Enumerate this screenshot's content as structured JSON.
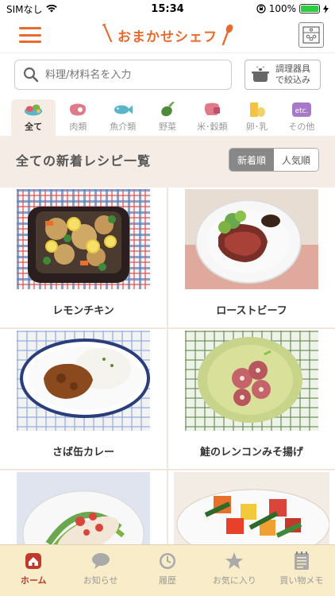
{
  "status_bar": {
    "carrier": "SIMなし",
    "time": "15:34",
    "battery": "100%",
    "battery_level": 1.0
  },
  "header": {
    "title": "おまかせシェフ"
  },
  "search": {
    "placeholder": "料理/材料名を入力",
    "appliance_label_1": "調理器具",
    "appliance_label_2": "で絞込み"
  },
  "categories": [
    {
      "label": "全て",
      "icon": "all-food-icon",
      "active": true
    },
    {
      "label": "肉類",
      "icon": "meat-icon"
    },
    {
      "label": "魚介類",
      "icon": "fish-icon"
    },
    {
      "label": "野菜",
      "icon": "eggplant-icon"
    },
    {
      "label": "米･穀類",
      "icon": "rice-icon"
    },
    {
      "label": "卵･乳",
      "icon": "egg-milk-icon"
    },
    {
      "label": "その他",
      "icon": "etc-icon"
    }
  ],
  "section": {
    "title": "全ての新着レシピ一覧",
    "sort_new": "新着順",
    "sort_popular": "人気順"
  },
  "recipes": [
    {
      "title": "レモンチキン"
    },
    {
      "title": "ローストビーフ"
    },
    {
      "title": "さば缶カレー"
    },
    {
      "title": "鮭のレンコンみそ揚げ"
    },
    {
      "title": ""
    },
    {
      "title": ""
    }
  ],
  "tabs": [
    {
      "label": "ホーム",
      "icon": "home-icon",
      "active": true
    },
    {
      "label": "お知らせ",
      "icon": "speech-bubble-icon"
    },
    {
      "label": "履歴",
      "icon": "clock-icon"
    },
    {
      "label": "お気に入り",
      "icon": "star-icon"
    },
    {
      "label": "買い物メモ",
      "icon": "notepad-icon"
    }
  ],
  "colors": {
    "accent": "#e86a2e",
    "tab_active": "#c0392b",
    "tabbar_bg": "#f9ecc8",
    "page_bg": "#f5ede5"
  }
}
